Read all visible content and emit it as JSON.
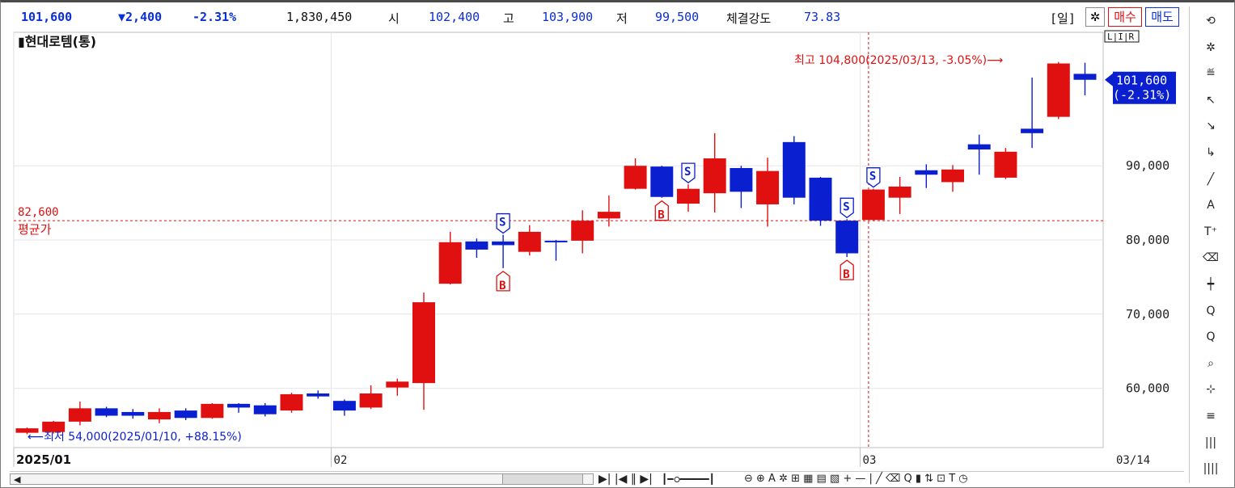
{
  "topbar": {
    "price": "101,600",
    "change": "▼2,400",
    "change_pct": "-2.31%",
    "volume": "1,830,450",
    "open_label": "시",
    "open": "102,400",
    "high_label": "고",
    "high": "103,900",
    "low_label": "저",
    "low": "99,500",
    "strength_label": "체결강도",
    "strength": "73.83",
    "period": "[일]",
    "buy": "매수",
    "sell": "매도"
  },
  "colors": {
    "up": "#e01010",
    "down": "#0a1fd0",
    "accent": "#0a2fd4",
    "avg_line": "#e01010"
  },
  "chart_data": {
    "type": "candlestick",
    "title": "현대로템(통)",
    "scale_badge": "L|I|R",
    "ylim": [
      52000,
      108000
    ],
    "y_ticks": [
      60000,
      70000,
      80000,
      90000
    ],
    "y_tick_labels": [
      "60,000",
      "70,000",
      "80,000",
      "90,000"
    ],
    "x_labels": [
      "2025/01",
      "02",
      "03",
      "03/14"
    ],
    "month_starts": [
      0,
      12,
      32
    ],
    "candles": [
      {
        "o": 54000,
        "h": 54700,
        "l": 53800,
        "c": 54600
      },
      {
        "o": 54100,
        "h": 55600,
        "l": 53900,
        "c": 55500
      },
      {
        "o": 55500,
        "h": 58200,
        "l": 55000,
        "c": 57300
      },
      {
        "o": 57300,
        "h": 57500,
        "l": 56100,
        "c": 56300
      },
      {
        "o": 56800,
        "h": 57200,
        "l": 55900,
        "c": 56300
      },
      {
        "o": 55800,
        "h": 57300,
        "l": 55300,
        "c": 56800
      },
      {
        "o": 57000,
        "h": 57300,
        "l": 55700,
        "c": 56000
      },
      {
        "o": 56000,
        "h": 58000,
        "l": 55900,
        "c": 57900
      },
      {
        "o": 57900,
        "h": 58000,
        "l": 56700,
        "c": 57400
      },
      {
        "o": 57700,
        "h": 58000,
        "l": 56200,
        "c": 56500
      },
      {
        "o": 57000,
        "h": 59400,
        "l": 56700,
        "c": 59200
      },
      {
        "o": 59300,
        "h": 59700,
        "l": 58600,
        "c": 58900
      },
      {
        "o": 58300,
        "h": 58500,
        "l": 56300,
        "c": 57000
      },
      {
        "o": 57400,
        "h": 60400,
        "l": 57200,
        "c": 59300
      },
      {
        "o": 60100,
        "h": 61300,
        "l": 59000,
        "c": 60900
      },
      {
        "o": 60700,
        "h": 72900,
        "l": 57100,
        "c": 71600
      },
      {
        "o": 74100,
        "h": 81100,
        "l": 74000,
        "c": 79700
      },
      {
        "o": 79800,
        "h": 80200,
        "l": 77600,
        "c": 78700
      },
      {
        "o": 79800,
        "h": 80700,
        "l": 76200,
        "c": 79300
      },
      {
        "o": 78400,
        "h": 82000,
        "l": 77900,
        "c": 81100
      },
      {
        "o": 79900,
        "h": 80000,
        "l": 77200,
        "c": 79800
      },
      {
        "o": 79900,
        "h": 84000,
        "l": 78200,
        "c": 82600
      },
      {
        "o": 82900,
        "h": 86000,
        "l": 81800,
        "c": 83800
      },
      {
        "o": 86900,
        "h": 91000,
        "l": 86800,
        "c": 90000
      },
      {
        "o": 89900,
        "h": 90000,
        "l": 85700,
        "c": 85800
      },
      {
        "o": 84900,
        "h": 87500,
        "l": 83800,
        "c": 86900
      },
      {
        "o": 86300,
        "h": 94400,
        "l": 83700,
        "c": 91000
      },
      {
        "o": 89700,
        "h": 90000,
        "l": 84300,
        "c": 86500
      },
      {
        "o": 84800,
        "h": 91100,
        "l": 81800,
        "c": 89300
      },
      {
        "o": 93200,
        "h": 94000,
        "l": 84800,
        "c": 85700
      },
      {
        "o": 88400,
        "h": 88500,
        "l": 81900,
        "c": 82600
      },
      {
        "o": 82600,
        "h": 82800,
        "l": 77700,
        "c": 78200
      },
      {
        "o": 82700,
        "h": 86900,
        "l": 82600,
        "c": 86800
      },
      {
        "o": 85700,
        "h": 88500,
        "l": 83500,
        "c": 87200
      },
      {
        "o": 89400,
        "h": 90200,
        "l": 87000,
        "c": 88800
      },
      {
        "o": 87800,
        "h": 90100,
        "l": 86500,
        "c": 89500
      },
      {
        "o": 92900,
        "h": 94200,
        "l": 88800,
        "c": 92200
      },
      {
        "o": 88400,
        "h": 92400,
        "l": 88200,
        "c": 91900
      },
      {
        "o": 95000,
        "h": 101900,
        "l": 92400,
        "c": 94400
      },
      {
        "o": 96600,
        "h": 104000,
        "l": 96300,
        "c": 103800
      },
      {
        "o": 102400,
        "h": 103900,
        "l": 99500,
        "c": 101600
      }
    ],
    "signals": [
      {
        "i": 18,
        "type": "S"
      },
      {
        "i": 18,
        "type": "B"
      },
      {
        "i": 24,
        "type": "B"
      },
      {
        "i": 25,
        "type": "S"
      },
      {
        "i": 31,
        "type": "S"
      },
      {
        "i": 31,
        "type": "B"
      },
      {
        "i": 32,
        "type": "S"
      }
    ],
    "avg_price": 82600,
    "avg_value_label": "82,600",
    "avg_label": "평균가",
    "high_note": "최고 104,800(2025/03/13, -3.05%)⟶",
    "high_note_index": 32,
    "low_note": "⟵최저 54,000(2025/01/10, +88.15%)",
    "last_label": "101,600",
    "last_pct_label": "(-2.31%)",
    "last_value": 101600
  },
  "sidebar": {
    "icons": [
      "refresh-icon",
      "gear-icon",
      "chart-icon",
      "pointer-plus-icon",
      "pointer-bar-icon",
      "pointer-corner-icon",
      "diagonal-line-icon",
      "auto-line-icon",
      "text-icon",
      "eraser-icon",
      "candle-icon",
      "zoom-in-icon",
      "zoom-list-icon",
      "zoom-chart-icon",
      "crosshair-chart-icon",
      "equal-icon",
      "bars-icon",
      "bars4-icon"
    ],
    "glyphs": [
      "⟲",
      "✲",
      "≝",
      "↖",
      "↘",
      "↳",
      "╱",
      "A",
      "T⁺",
      "⌫",
      "┿",
      "Q",
      "Q",
      "⌕",
      "⊹",
      "≡",
      "|||",
      "||||"
    ]
  },
  "bottombar": {
    "controls": "▶| |◀ ‖ ▶|",
    "zoom_controls": "⊖ ⊕ A ✲ ⊞ ▦ ▤ ▧ + — | ╱ ⌫ Q ▮ ⇅ ⊡ T ◷"
  }
}
